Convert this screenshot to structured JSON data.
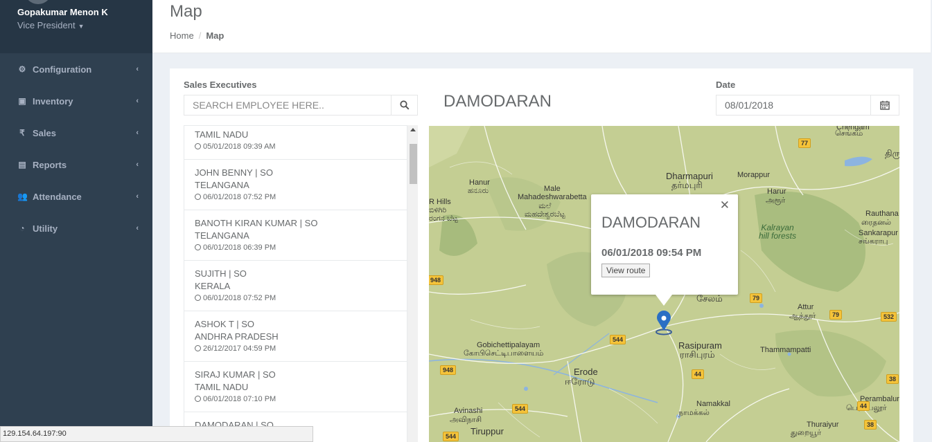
{
  "user": {
    "name": "Gopakumar Menon K",
    "role": "Vice President"
  },
  "sidebar": {
    "items": [
      {
        "label": "Configuration",
        "icon": "gear-icon"
      },
      {
        "label": "Inventory",
        "icon": "briefcase-icon"
      },
      {
        "label": "Sales",
        "icon": "rupee-icon"
      },
      {
        "label": "Reports",
        "icon": "document-icon"
      },
      {
        "label": "Attendance",
        "icon": "users-icon"
      },
      {
        "label": "Utility",
        "icon": "dashboard-icon"
      }
    ]
  },
  "header": {
    "title": "Map",
    "breadcrumb_home": "Home",
    "breadcrumb_sep": "/",
    "breadcrumb_current": "Map"
  },
  "sales_exec": {
    "label": "Sales Executives",
    "search_placeholder": "SEARCH EMPLOYEE HERE..",
    "items": [
      {
        "name": "",
        "region": "TAMIL NADU",
        "time": "05/01/2018 09:39 AM"
      },
      {
        "name": "JOHN BENNY | SO",
        "region": "TELANGANA",
        "time": "06/01/2018 07:52 PM"
      },
      {
        "name": "BANOTH KIRAN KUMAR | SO",
        "region": "TELANGANA",
        "time": "06/01/2018 06:39 PM"
      },
      {
        "name": "SUJITH | SO",
        "region": "KERALA",
        "time": "06/01/2018 07:52 PM"
      },
      {
        "name": "ASHOK T | SO",
        "region": "ANDHRA PRADESH",
        "time": "26/12/2017 04:59 PM"
      },
      {
        "name": "SIRAJ KUMAR | SO",
        "region": "TAMIL NADU",
        "time": "06/01/2018 07:10 PM"
      },
      {
        "name": "DAMODARAN | SO",
        "region": "",
        "time": ""
      }
    ]
  },
  "selected_exec": "DAMODARAN",
  "date": {
    "label": "Date",
    "value": "08/01/2018"
  },
  "popup": {
    "title": "DAMODARAN",
    "time": "06/01/2018 09:54 PM",
    "button": "View route"
  },
  "map_labels": {
    "dharmapuri": "Dharmapuri",
    "dharmapuri_ta": "தர்மபுரி",
    "morappur": "Morappur",
    "harur": "Harur",
    "harur_ta": "அரூர்",
    "hanur": "Hanur",
    "hanur_kn": "ಹನೂರು",
    "male_mahadeshwara": "Male\nMahadeshwarabetta",
    "mm_kn": "ಮಲೆ\nಮಹದೇಶ್ವರಬೆಟ್ಟ",
    "hills": "R Hills",
    "hills_kn": "ಬಿಳಿಗಿರಿ\nರಂಗನ ಬೆಟ್ಟ",
    "kalrayan": "Kalrayan\nhill forests",
    "rauthana": "Rauthana",
    "rauthana_ta": "ரைதனல்",
    "sankarapuram": "Sankarapur",
    "sankarapuram_ta": "சங்கராபு",
    "chengam": "Chengam",
    "chengam_ta": "செங்கம்",
    "salem_ta": "சேலம்",
    "attur": "Attur",
    "attur_ta": "ஆத்தூர்",
    "rasipuram": "Rasipuram",
    "rasipuram_ta": "ராசிபுரம்",
    "thammampatti": "Thammampatti",
    "gobi": "Gobichettipalayam",
    "gobi_ta": "கோபிசெட்டிபாளையம்",
    "erode": "Erode",
    "erode_ta": "ஈரோடு",
    "namakkal": "Namakkal",
    "namakkal_ta": "நாமக்கல்",
    "avinashi": "Avinashi",
    "avinashi_ta": "அவிநாசி",
    "tiruppur": "Tiruppur",
    "perambalur": "Perambalur",
    "perambalur_ta": "பெரம்பலூர்",
    "thuraiyur": "Thuraiyur",
    "thuraiyur_ta": "துறையூர்",
    "thiru_ta": "திரு",
    "shields": [
      "77",
      "948",
      "79",
      "79",
      "532",
      "544",
      "948",
      "44",
      "544",
      "38",
      "544",
      "38",
      "44"
    ]
  },
  "status_bar": "129.154.64.197:90"
}
